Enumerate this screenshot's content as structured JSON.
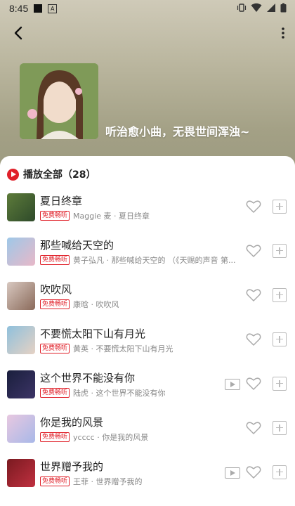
{
  "status": {
    "time": "8:45",
    "a_label": "A"
  },
  "header": {
    "headline": "听治愈小曲，无畏世间浑浊~"
  },
  "playlist": {
    "play_all_label": "播放全部（28）"
  },
  "songs": [
    {
      "title": "夏日终章",
      "badge": "免费畅听",
      "subtitle": "Maggie 麦 · 夏日终章",
      "has_video": false,
      "thumb_colors": [
        "#5d7b3a",
        "#2e4a2a"
      ]
    },
    {
      "title": "那些喊给天空的",
      "badge": "免费畅听",
      "subtitle": "黄子弘凡 · 那些喊给天空的 （《天赐的声音 第...",
      "has_video": false,
      "thumb_colors": [
        "#9ec8e8",
        "#e8b8c8"
      ]
    },
    {
      "title": "吹吹风",
      "badge": "免费畅听",
      "subtitle": "康晗 · 吹吹风",
      "has_video": false,
      "thumb_colors": [
        "#d8c8c0",
        "#8a6a5a"
      ]
    },
    {
      "title": "不要慌太阳下山有月光",
      "badge": "免费畅听",
      "subtitle": "黄英 · 不要慌太阳下山有月光",
      "has_video": false,
      "thumb_colors": [
        "#8fc0dc",
        "#e6d2c4"
      ]
    },
    {
      "title": "这个世界不能没有你",
      "badge": "免费畅听",
      "subtitle": "陆虎 · 这个世界不能没有你",
      "has_video": true,
      "thumb_colors": [
        "#1a1f3d",
        "#3c3466"
      ]
    },
    {
      "title": "你是我的风景",
      "badge": "免费畅听",
      "subtitle": "ycccc · 你是我的风景",
      "has_video": false,
      "thumb_colors": [
        "#e8c8e0",
        "#a8b8e8"
      ]
    },
    {
      "title": "世界赠予我的",
      "badge": "免费畅听",
      "subtitle": "王菲 · 世界赠予我的",
      "has_video": true,
      "thumb_colors": [
        "#7a1a20",
        "#c03040"
      ]
    }
  ]
}
